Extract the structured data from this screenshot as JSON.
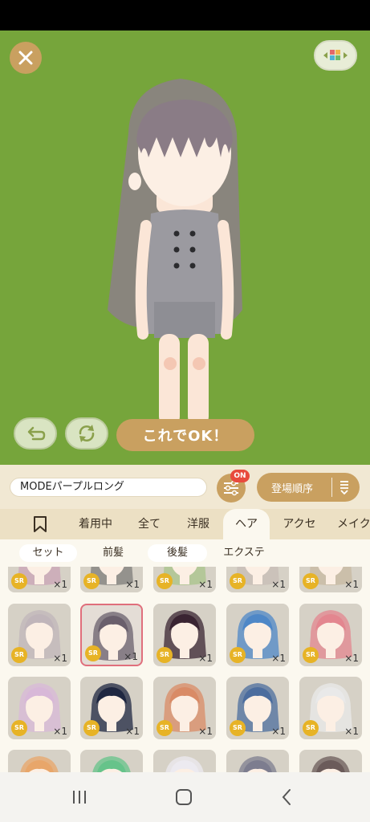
{
  "header": {
    "close_icon": "close-icon",
    "layout_icon": "color-grid-icon"
  },
  "stage": {
    "bg_color": "#76a53b",
    "ok_label": "これでOK！",
    "undo_icon": "undo-icon",
    "rotate_icon": "rotate-icon"
  },
  "toolbar": {
    "outfit_name": "MODEパープルロング",
    "filter_badge": "ON",
    "sort_label": "登場順序",
    "filter_icon": "sliders-icon",
    "sort_icon": "sort-order-icon"
  },
  "tabs": [
    {
      "label": "着用中"
    },
    {
      "label": "全て"
    },
    {
      "label": "洋服"
    },
    {
      "label": "ヘア"
    },
    {
      "label": "アクセ"
    },
    {
      "label": "メイク"
    }
  ],
  "subtabs": [
    {
      "label": "セット"
    },
    {
      "label": "前髪"
    },
    {
      "label": "後髪"
    },
    {
      "label": "エクステ"
    }
  ],
  "items": {
    "rarity": "SR",
    "quantity": "×1",
    "colors": [
      "#c9a3b6",
      "#7d7c7a",
      "#a8c38a",
      "#c7bcb6",
      "#c7b8a0",
      "#c0b5ba",
      "#6a5f6c",
      "#3a2432",
      "#4e87c7",
      "#e3868f",
      "#d8b8d8",
      "#1f2741",
      "#d98b66",
      "#4c6d9e",
      "#e9e9e9",
      "#e8a66a",
      "#66c38a",
      "#eceaf0",
      "#7d7d8f",
      "#6b5b5a"
    ]
  },
  "nav": {
    "recent": "recent-apps-icon",
    "home": "home-icon",
    "back": "back-icon"
  }
}
